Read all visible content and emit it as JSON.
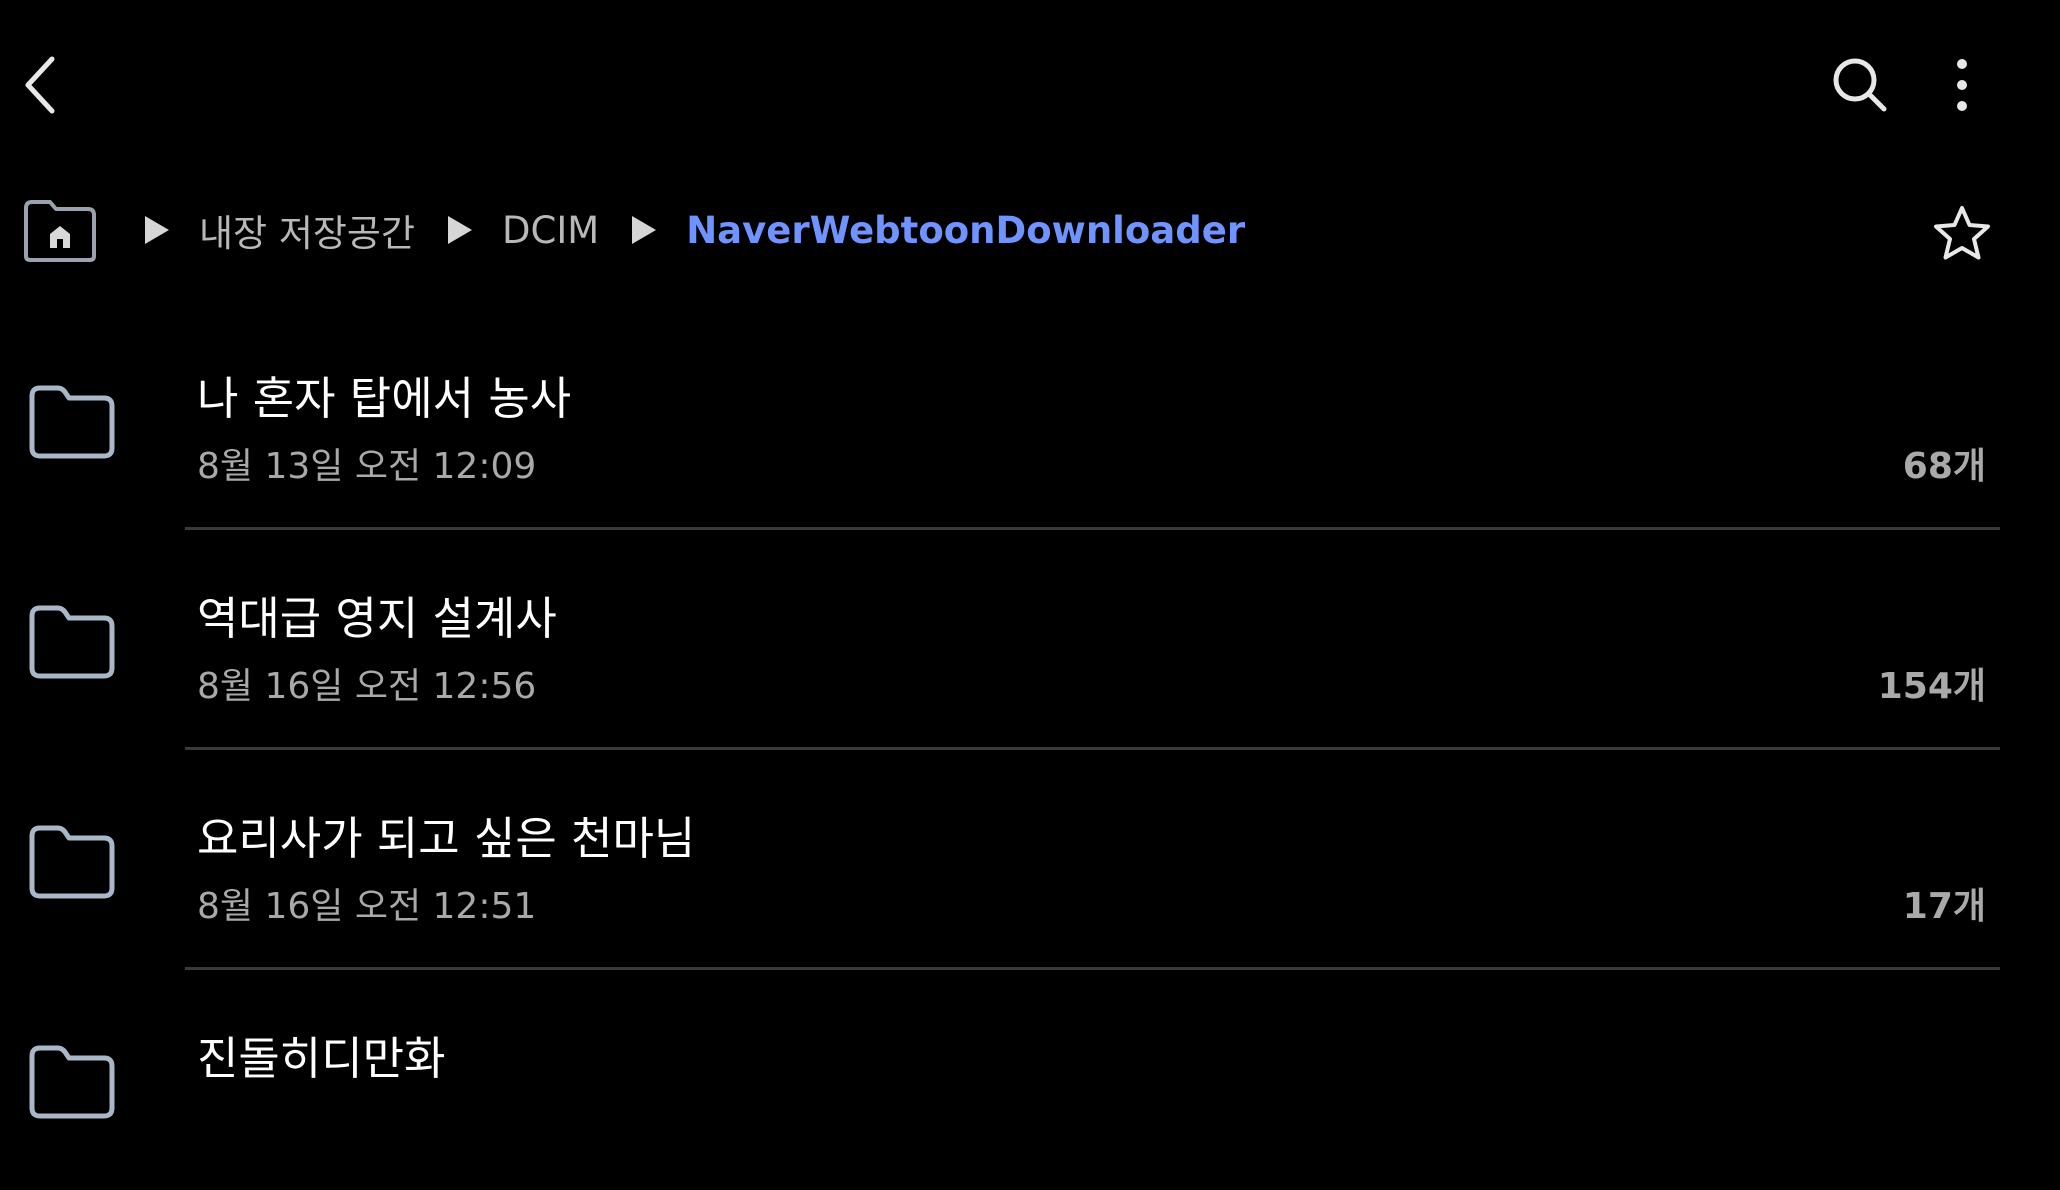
{
  "topbar": {
    "back_icon": "chevron-left-icon",
    "search_icon": "search-icon",
    "more_icon": "more-vertical-icon"
  },
  "breadcrumb": {
    "home_icon": "home-folder-icon",
    "items": [
      "내장 저장공간",
      "DCIM",
      "NaverWebtoonDownloader"
    ],
    "favorite_icon": "star-icon",
    "current_color": "#6f93ff"
  },
  "folders": [
    {
      "name": "나 혼자 탑에서 농사",
      "modified": "8월 13일 오전 12:09",
      "count": "68개"
    },
    {
      "name": "역대급 영지 설계사",
      "modified": "8월 16일 오전 12:56",
      "count": "154개"
    },
    {
      "name": "요리사가 되고 싶은 천마님",
      "modified": "8월 16일 오전 12:51",
      "count": "17개"
    },
    {
      "name": "진돌히디만화"
    }
  ]
}
